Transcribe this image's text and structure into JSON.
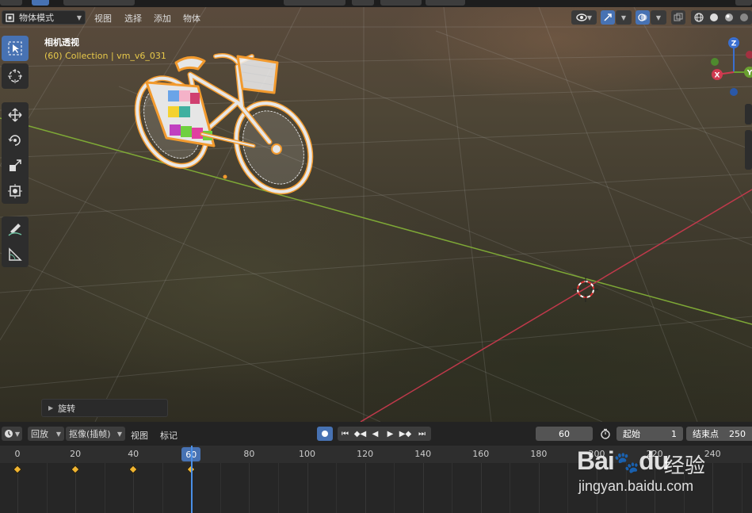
{
  "viewport": {
    "mode_select": "物体模式",
    "menus": [
      "视图",
      "选择",
      "添加",
      "物体"
    ],
    "title": "相机透视",
    "collection": "(60) Collection | vm_v6_031",
    "gizmo_axes": [
      "Z",
      "X",
      "Y"
    ],
    "redo_panel_label": "旋转",
    "tools": [
      "select-box-tool",
      "cursor-tool",
      "move-tool",
      "rotate-tool",
      "scale-tool",
      "transform-tool",
      "annotate-tool",
      "measure-tool"
    ]
  },
  "timeline": {
    "playback_label": "回放",
    "keying_label": "抠像(插帧)",
    "view_menu": "视图",
    "marker_menu": "标记",
    "current_frame": "60",
    "start_label": "起始",
    "start_value": "1",
    "end_label": "结束点",
    "end_value": "250",
    "ruler_ticks": [
      "0",
      "20",
      "40",
      "60",
      "80",
      "100",
      "120",
      "140",
      "160",
      "180",
      "200",
      "220",
      "240"
    ],
    "keyframes": [
      0,
      20,
      40,
      60
    ],
    "key_color": "#f0b430"
  },
  "watermark": {
    "brand": "Bai",
    "brand_suffix": "du",
    "chinese": "经验",
    "url": "jingyan.baidu.com"
  },
  "colors": {
    "accent": "#4772b3",
    "selection_outline": "#f29a2e",
    "x_axis": "#c0394b",
    "y_axis": "#7ea836",
    "collection_text": "#e8c94a"
  }
}
